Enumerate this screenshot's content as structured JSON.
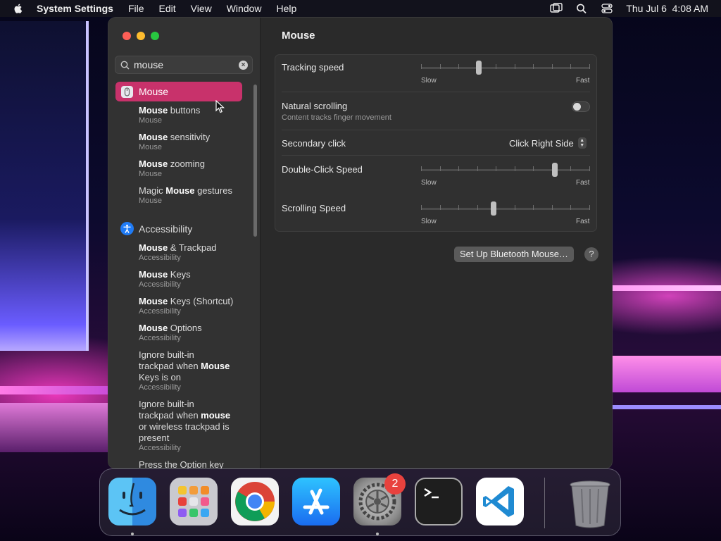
{
  "menubar": {
    "app_name": "System Settings",
    "menus": [
      "File",
      "Edit",
      "View",
      "Window",
      "Help"
    ],
    "datetime": "Thu Jul 6  4:08 AM"
  },
  "sidebar": {
    "search": {
      "value": "mouse"
    },
    "selected": {
      "label": "Mouse",
      "icon": "mouse-icon"
    },
    "mouse_results": [
      {
        "bold": "Mouse",
        "rest": " buttons",
        "sub": "Mouse"
      },
      {
        "bold": "Mouse",
        "rest": " sensitivity",
        "sub": "Mouse"
      },
      {
        "bold": "Mouse",
        "rest": " zooming",
        "sub": "Mouse"
      },
      {
        "pre": "Magic ",
        "bold": "Mouse",
        "rest": " gestures",
        "sub": "Mouse"
      }
    ],
    "accessibility_section": {
      "label": "Accessibility",
      "icon": "accessibility-icon"
    },
    "accessibility_results": [
      {
        "bold": "Mouse",
        "rest": " & Trackpad",
        "sub": "Accessibility"
      },
      {
        "bold": "Mouse",
        "rest": " Keys",
        "sub": "Accessibility"
      },
      {
        "bold": "Mouse",
        "rest": " Keys (Shortcut)",
        "sub": "Accessibility"
      },
      {
        "bold": "Mouse",
        "rest": " Options",
        "sub": "Accessibility"
      },
      {
        "lines": [
          "Ignore built-in",
          "trackpad when |Mouse|",
          "Keys is on"
        ],
        "sub": "Accessibility"
      },
      {
        "lines": [
          "Ignore built-in",
          "trackpad when |mouse|",
          "or wireless trackpad is",
          "present"
        ],
        "sub": "Accessibility"
      },
      {
        "lines": [
          "Press the Option key"
        ],
        "sub": ""
      }
    ]
  },
  "main": {
    "title": "Mouse",
    "tracking_speed": {
      "label": "Tracking speed",
      "min_label": "Slow",
      "max_label": "Fast",
      "level": 0.34
    },
    "natural_scrolling": {
      "label": "Natural scrolling",
      "sub": "Content tracks finger movement",
      "on": false
    },
    "secondary_click": {
      "label": "Secondary click",
      "value": "Click Right Side"
    },
    "double_click_speed": {
      "label": "Double-Click Speed",
      "min_label": "Slow",
      "max_label": "Fast",
      "level": 0.79
    },
    "scrolling_speed": {
      "label": "Scrolling Speed",
      "min_label": "Slow",
      "max_label": "Fast",
      "level": 0.43
    },
    "bluetooth_button": "Set Up Bluetooth Mouse…",
    "help_button": "?"
  },
  "dock": {
    "apps": [
      "Finder",
      "Launchpad",
      "Google Chrome",
      "App Store",
      "System Settings",
      "Terminal",
      "Visual Studio Code",
      "Trash"
    ],
    "system_settings_badge": "2"
  },
  "colors": {
    "accent": "#c8326b",
    "window_bg": "#2a2a2a",
    "sidebar_bg": "#323232"
  }
}
